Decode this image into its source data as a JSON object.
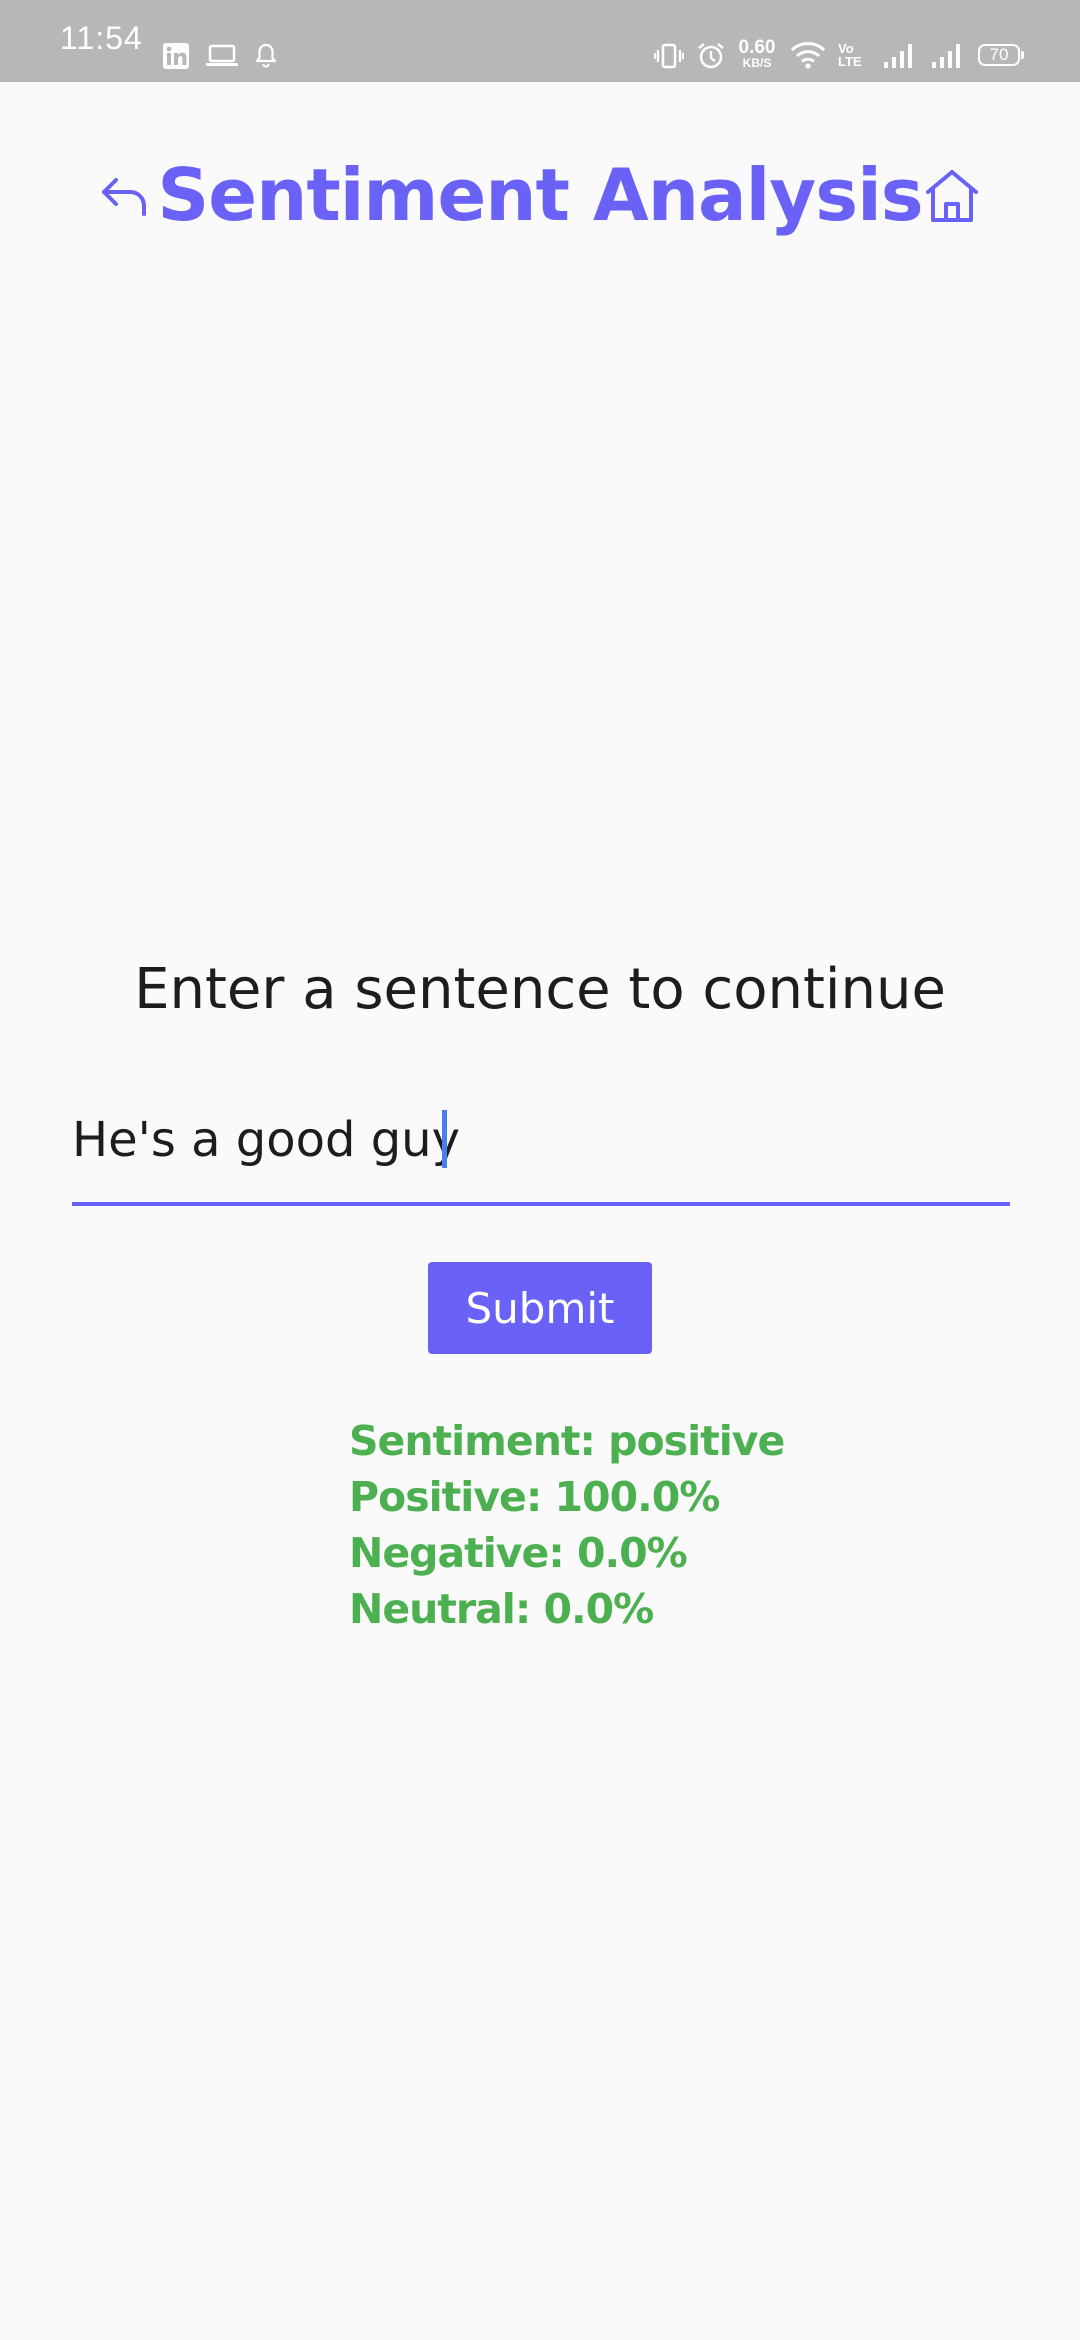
{
  "status_bar": {
    "time": "11:54",
    "speed_value": "0.60",
    "speed_unit": "KB/S",
    "volte_top": "Vo",
    "volte_bottom": "LTE",
    "battery": "70",
    "icons": [
      "linkedin-icon",
      "laptop-icon",
      "bell-icon",
      "vibrate-icon",
      "alarm-icon",
      "wifi-icon",
      "signal-icon",
      "signal-icon",
      "battery-icon"
    ]
  },
  "header": {
    "title": "Sentiment Analysis",
    "back_icon": "back-arrow-icon",
    "home_icon": "home-icon"
  },
  "main": {
    "prompt": "Enter a sentence to continue",
    "input_value": "He's a good guy",
    "submit_label": "Submit",
    "results": {
      "sentiment": "Sentiment: positive",
      "positive": "Positive: 100.0%",
      "negative": "Negative: 0.0%",
      "neutral": "Neutral: 0.0%"
    }
  },
  "colors": {
    "accent": "#6a61f6",
    "result_text": "#4caf50",
    "status_bar_bg": "#b7b7b7",
    "background": "#fafafa"
  }
}
